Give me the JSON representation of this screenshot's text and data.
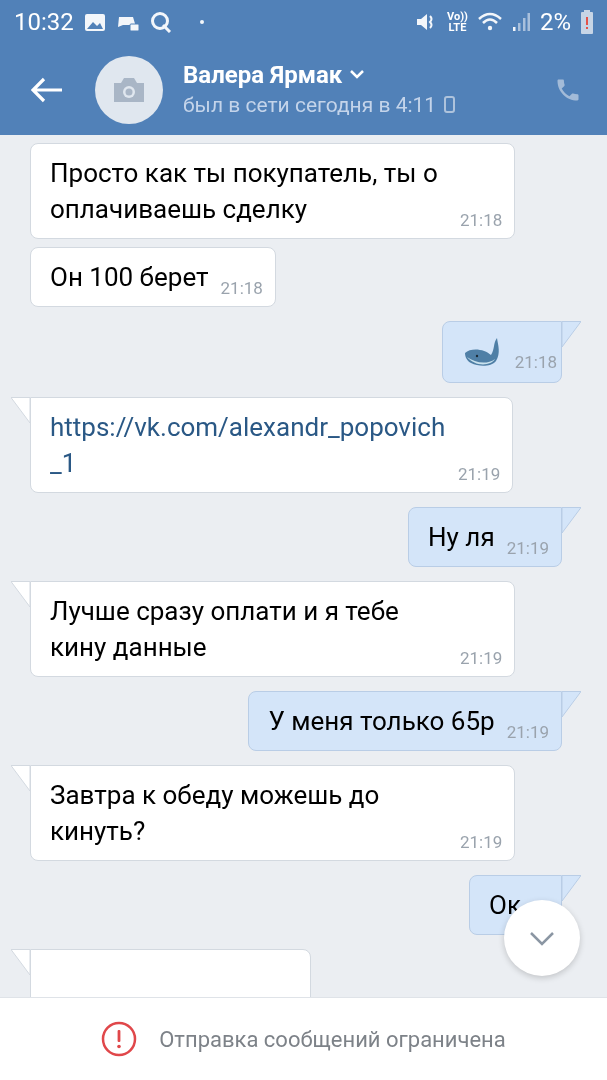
{
  "status_bar": {
    "time": "10:32",
    "volte_top": "Vo))",
    "volte_bottom": "LTE",
    "battery": "2%"
  },
  "header": {
    "name": "Валера Ярмак",
    "status": "был в сети сегодня в 4:11"
  },
  "messages": [
    {
      "kind": "text",
      "outgoing": false,
      "tail": false,
      "text": "Просто как ты покупатель, ты о оплачиваешь сделку",
      "time": "21:18"
    },
    {
      "kind": "text",
      "outgoing": false,
      "tail": false,
      "text": "Он 100 берет",
      "time": "21:18"
    },
    {
      "kind": "sticker",
      "outgoing": true,
      "tail": true,
      "time": "21:18"
    },
    {
      "kind": "link",
      "outgoing": false,
      "tail": true,
      "text": "https://vk.com/alexandr_popovich_1",
      "time": "21:19"
    },
    {
      "kind": "text",
      "outgoing": true,
      "tail": true,
      "text": "Ну ля",
      "time": "21:19"
    },
    {
      "kind": "text",
      "outgoing": false,
      "tail": true,
      "text": "Лучше сразу оплати и я тебе кину данные",
      "time": "21:19"
    },
    {
      "kind": "text",
      "outgoing": true,
      "tail": true,
      "text": "У меня только 65р",
      "time": "21:19"
    },
    {
      "kind": "text",
      "outgoing": false,
      "tail": true,
      "text": "Завтра к обеду можешь до кинуть?",
      "time": "21:19"
    },
    {
      "kind": "text",
      "outgoing": true,
      "tail": true,
      "text": "Ок"
    },
    {
      "kind": "cut",
      "outgoing": false,
      "tail": true
    }
  ],
  "notice": {
    "text": "Отправка сообщений ограничена"
  }
}
